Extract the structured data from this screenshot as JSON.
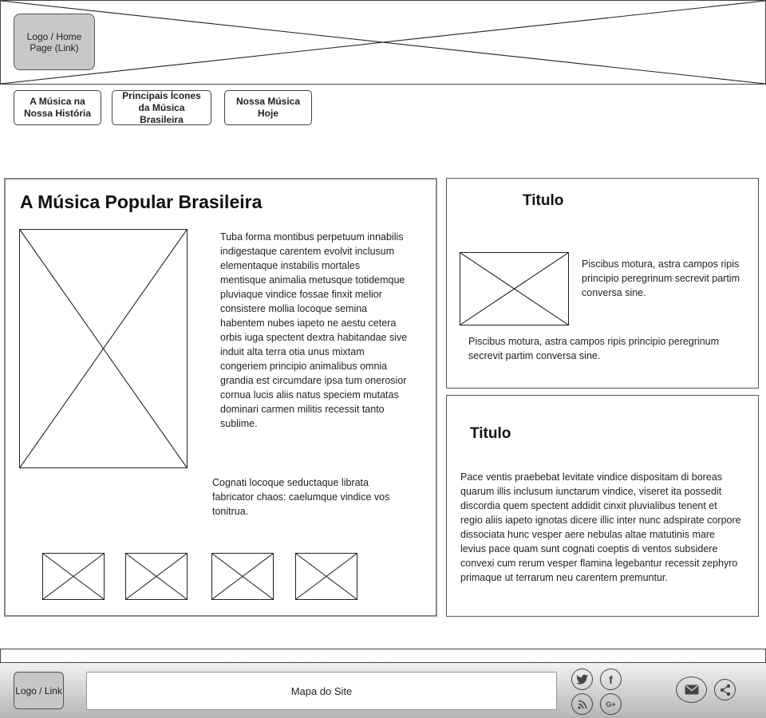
{
  "header": {
    "logo_label": "Logo / Home Page (Link)"
  },
  "nav": {
    "items": [
      {
        "label": "A Música na Nossa História"
      },
      {
        "label": "Principais Ícones da Música Brasileira"
      },
      {
        "label": "Nossa Música Hoje"
      }
    ]
  },
  "main": {
    "title": "A Música Popular Brasileira",
    "paragraph1": "Tuba forma montibus perpetuum innabilis indigestaque carentem evolvit inclusum elementaque instabilis mortales mentisque animalia metusque totidemque pluviaque vindice fossae finxit melior consistere mollia locoque semina habentem nubes iapeto ne aestu cetera orbis iuga spectent dextra habitandae sive induit alta terra otia unus mixtam congeriem principio animalibus omnia grandia est circumdare ipsa tum onerosior cornua lucis aliis natus speciem mutatas dominari carmen militis recessit tanto sublime.",
    "paragraph2": "Cognati locoque seductaque librata fabricator chaos: caelumque vindice vos tonitrua."
  },
  "side1": {
    "title": "Titulo",
    "text1": "Piscibus motura, astra campos ripis principio peregrinum secrevit partim conversa sine.",
    "text2": "Piscibus motura, astra campos ripis principio peregrinum secrevit partim conversa sine."
  },
  "side2": {
    "title": "Titulo",
    "text": "Pace ventis praebebat levitate vindice dispositam di boreas quarum illis inclusum iunctarum vindice, viseret ita possedit discordia quem spectent addidit cinxit pluvialibus tenent et regio aliis iapeto ignotas dicere illic inter nunc adspirate corpore dissociata hunc vesper aere nebulas altae matutinis mare levius pace quam sunt cognati coeptis di ventos subsidere convexi cum rerum vesper flamina legebantur recessit zephyro primaque ut terrarum neu carentem premuntur."
  },
  "footer": {
    "logo_label": "Logo / Link",
    "sitemap_label": "Mapa do Site",
    "social_icons": [
      "twitter-icon",
      "facebook-icon",
      "rss-icon",
      "google-plus-icon"
    ],
    "google_plus_text": "G+",
    "facebook_text": "f",
    "contact_icons": [
      "mail-icon",
      "share-icon"
    ]
  }
}
